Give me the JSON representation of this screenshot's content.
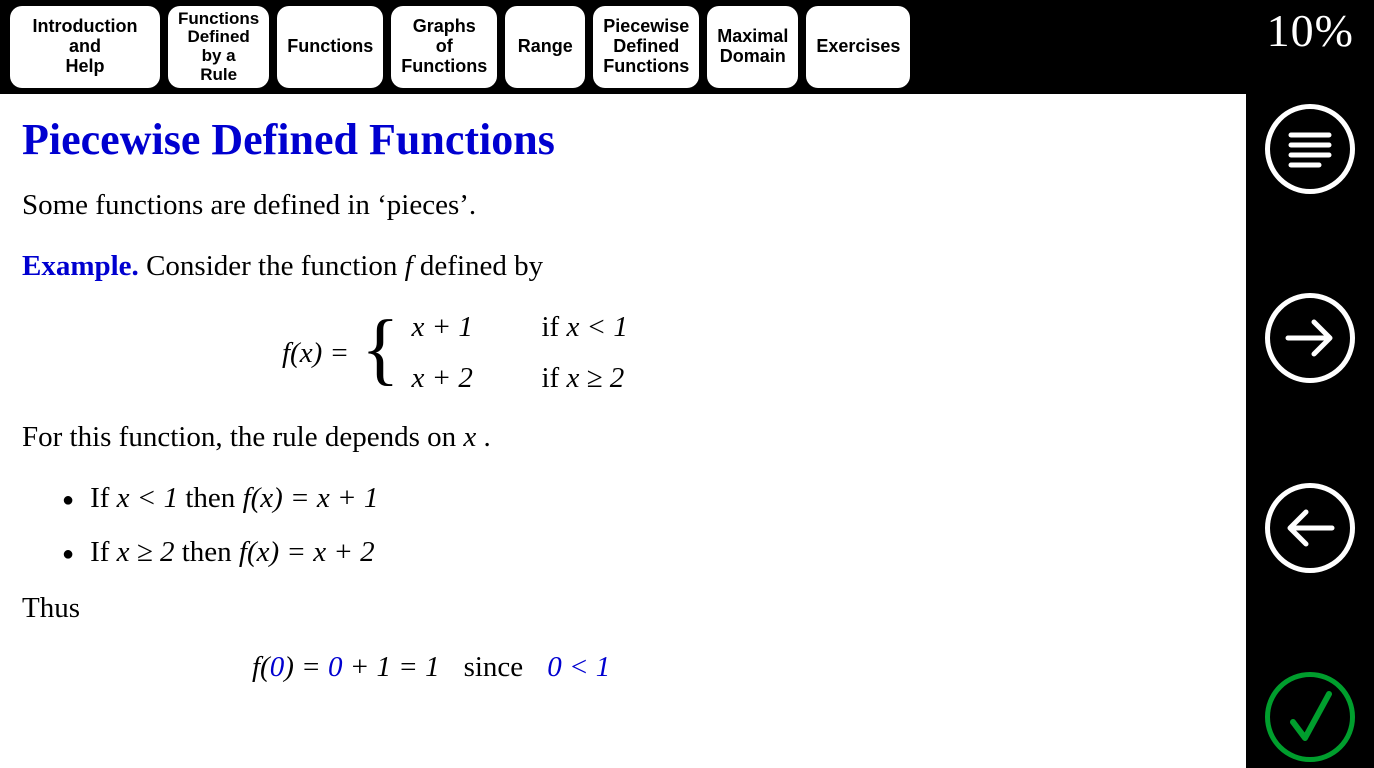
{
  "nav": {
    "items": [
      {
        "label": "Introduction\nand\nHelp"
      },
      {
        "label": "Functions\nDefined\nby a\nRule"
      },
      {
        "label": "Functions"
      },
      {
        "label": "Graphs\nof\nFunctions"
      },
      {
        "label": "Range"
      },
      {
        "label": "Piecewise\nDefined\nFunctions"
      },
      {
        "label": "Maximal\nDomain"
      },
      {
        "label": "Exercises"
      }
    ]
  },
  "progress": "10%",
  "page": {
    "title": "Piecewise Defined Functions",
    "intro": "Some functions are defined in ‘pieces’.",
    "example_label": "Example.",
    "example_text": " Consider the function ",
    "example_text2": " defined by",
    "fx_label": "f(x) = ",
    "cases": [
      {
        "expr": "x + 1",
        "cond_prefix": "if ",
        "cond": "x < 1"
      },
      {
        "expr": "x + 2",
        "cond_prefix": "if ",
        "cond": "x ≥ 2"
      }
    ],
    "depends_line_a": "For this function, the rule depends on ",
    "depends_line_b": " .",
    "bullets": [
      {
        "prefix": "If ",
        "cond": "x < 1",
        "then": " then  ",
        "eq": "f(x) = x + 1"
      },
      {
        "prefix": "If ",
        "cond": "x ≥ 2",
        "then": " then  ",
        "eq": "f(x) = x + 2"
      }
    ],
    "thus": "Thus",
    "final": {
      "f_open": "f(",
      "arg": "0",
      "f_close": ") = ",
      "sub": "0",
      "plus": " + 1 = 1",
      "since": "since",
      "cond": "0 < 1"
    }
  },
  "sidebar": {
    "menu": "menu",
    "next": "next",
    "prev": "previous",
    "ok": "check"
  }
}
